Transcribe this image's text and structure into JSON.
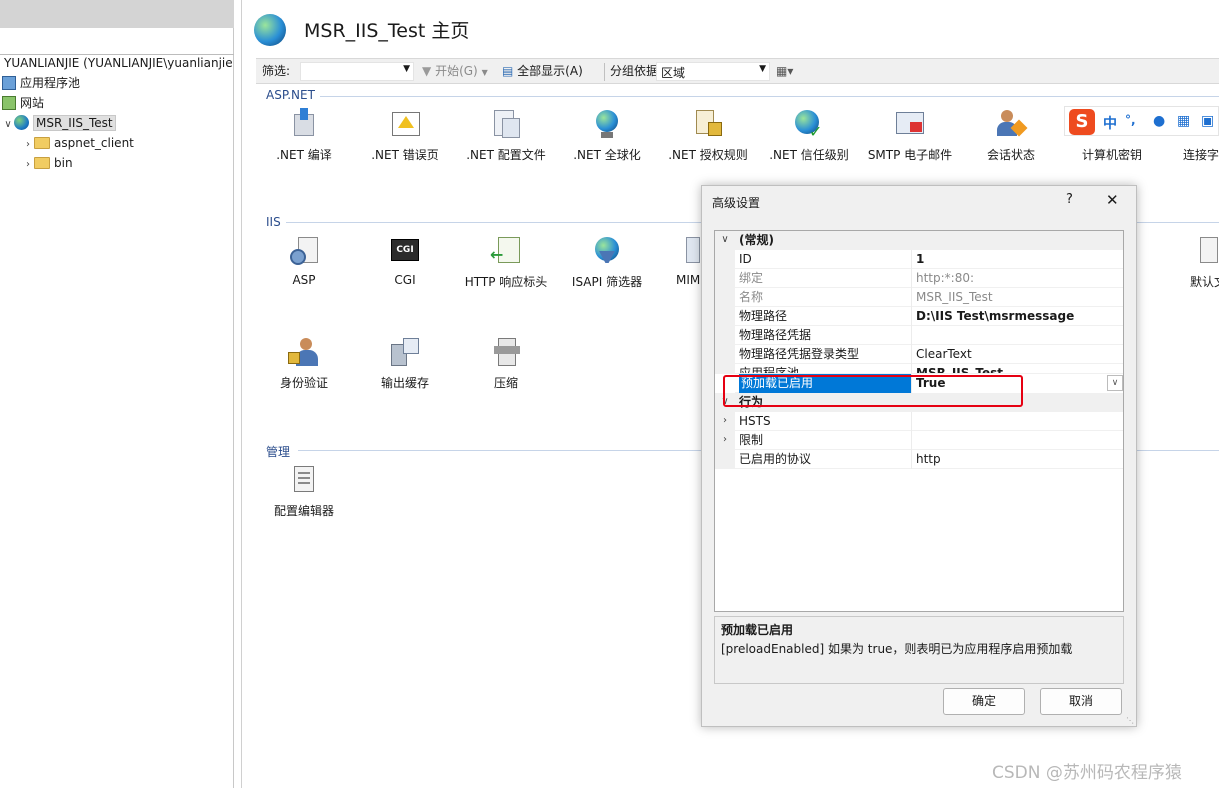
{
  "tree": {
    "connection": "YUANLIANJIE (YUANLIANJIE\\yuanlianjie",
    "items": [
      {
        "label": "应用程序池"
      },
      {
        "label": "网站"
      },
      {
        "label": "MSR_IIS_Test"
      },
      {
        "label": "aspnet_client"
      },
      {
        "label": "bin"
      }
    ]
  },
  "main": {
    "title": "MSR_IIS_Test 主页",
    "filter": {
      "label": "筛选:",
      "start": "开始(G)",
      "show_all": "全部显示(A)",
      "group_by": "分组依据:",
      "group_value": "区域"
    },
    "sections": [
      {
        "name": "ASP.NET",
        "features": [
          ".NET 编译",
          ".NET 错误页",
          ".NET 配置文件",
          ".NET 全球化",
          ".NET 授权规则",
          ".NET 信任级别",
          "SMTP 电子邮件",
          "会话状态",
          "计算机密钥",
          "连接字"
        ]
      },
      {
        "name": "IIS",
        "features": [
          "ASP",
          "CGI",
          "HTTP 响应标头",
          "ISAPI 筛选器",
          "MIM",
          "默认文",
          "身份验证",
          "输出缓存",
          "压缩"
        ]
      },
      {
        "name": "管理",
        "features": [
          "配置编辑器"
        ]
      }
    ]
  },
  "dialog": {
    "title": "高级设置",
    "help": "?",
    "close": "✕",
    "rows": [
      {
        "name": "(常规)",
        "value": ""
      },
      {
        "name": "ID",
        "value": "1"
      },
      {
        "name": "绑定",
        "value": "http:*:80:"
      },
      {
        "name": "名称",
        "value": "MSR_IIS_Test"
      },
      {
        "name": "物理路径",
        "value": "D:\\IIS Test\\msrmessage"
      },
      {
        "name": "物理路径凭据",
        "value": ""
      },
      {
        "name": "物理路径凭据登录类型",
        "value": "ClearText"
      },
      {
        "name": "应用程序池",
        "value": "MSR_IIS_Test"
      },
      {
        "name": "预加载已启用",
        "value": "True"
      },
      {
        "name": "行为",
        "value": ""
      },
      {
        "name": "HSTS",
        "value": ""
      },
      {
        "name": "限制",
        "value": ""
      },
      {
        "name": "已启用的协议",
        "value": "http"
      }
    ],
    "desc_title": "预加载已启用",
    "desc_text": "[preloadEnabled] 如果为 true，则表明已为应用程序启用预加载",
    "ok": "确定",
    "cancel": "取消"
  },
  "ime": {
    "mode": "中",
    "punct": "°,"
  },
  "watermark": "CSDN @苏州码农程序猿"
}
